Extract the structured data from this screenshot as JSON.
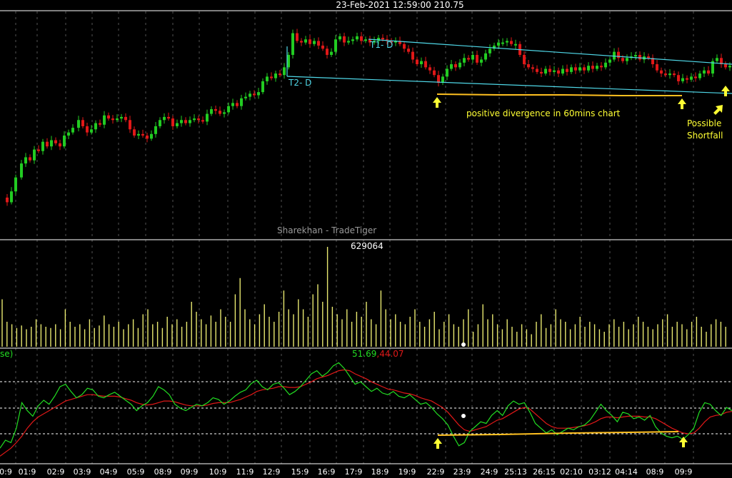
{
  "header": {
    "title": "23-Feb-2021  12:59:00  210.75"
  },
  "watermark": "Sharekhan - TradeTiger",
  "volume_panel": {
    "label": "629064"
  },
  "rsi_panel": {
    "legend_prefix": "se)",
    "value1": "51.69",
    "separator": ",",
    "value2": "44.07"
  },
  "annotations": {
    "trendline_upper": "T1- D",
    "trendline_lower": "T2- D",
    "divergence_text": "positive divergence in 60mins chart",
    "shortfall_line1": "Possible",
    "shortfall_line2": "Shortfall"
  },
  "x_axis_labels": [
    "0:9",
    "01:9",
    "02:9",
    "03:9",
    "04:9",
    "05:9",
    "08:9",
    "09:9",
    "10:9",
    "11:9",
    "12:9",
    "15:9",
    "16:9",
    "17:9",
    "18:9",
    "19:9",
    "22:9",
    "23:9",
    "24:9",
    "25:13",
    "26:15",
    "02:10",
    "03:12",
    "04:14",
    "08:9",
    "09:9"
  ],
  "colors": {
    "background": "#000000",
    "up_candle": "#22cc22",
    "down_candle": "#e01818",
    "trendline": "#4fd8e8",
    "volume": "#e8e870",
    "rsi_line": "#22dd22",
    "rsi_avg": "#e01818",
    "annotation": "#ffff33",
    "support_line": "#ffc020",
    "grid": "#ffffff",
    "text": "#ffffff"
  },
  "chart_data": [
    {
      "type": "candlestick",
      "title": "23-Feb-2021  12:59:00  210.75",
      "close_path": [
        [
          0,
          0.16
        ],
        [
          8,
          0.13
        ],
        [
          14,
          0.2
        ],
        [
          20,
          0.29
        ],
        [
          28,
          0.38
        ],
        [
          34,
          0.42
        ],
        [
          40,
          0.4
        ],
        [
          46,
          0.47
        ],
        [
          52,
          0.46
        ],
        [
          58,
          0.52
        ],
        [
          64,
          0.49
        ],
        [
          70,
          0.53
        ],
        [
          76,
          0.51
        ],
        [
          82,
          0.49
        ],
        [
          88,
          0.56
        ],
        [
          94,
          0.58
        ],
        [
          100,
          0.61
        ],
        [
          108,
          0.66
        ],
        [
          114,
          0.62
        ],
        [
          120,
          0.58
        ],
        [
          126,
          0.6
        ],
        [
          132,
          0.64
        ],
        [
          138,
          0.63
        ],
        [
          144,
          0.69
        ],
        [
          150,
          0.67
        ],
        [
          156,
          0.66
        ],
        [
          162,
          0.67
        ],
        [
          168,
          0.68
        ],
        [
          174,
          0.66
        ],
        [
          180,
          0.6
        ],
        [
          186,
          0.56
        ],
        [
          192,
          0.57
        ],
        [
          198,
          0.56
        ],
        [
          204,
          0.54
        ],
        [
          210,
          0.57
        ],
        [
          216,
          0.62
        ],
        [
          222,
          0.66
        ],
        [
          228,
          0.68
        ],
        [
          234,
          0.67
        ],
        [
          240,
          0.62
        ],
        [
          246,
          0.64
        ],
        [
          252,
          0.66
        ],
        [
          258,
          0.64
        ],
        [
          264,
          0.66
        ],
        [
          270,
          0.67
        ],
        [
          276,
          0.66
        ],
        [
          282,
          0.65
        ],
        [
          288,
          0.7
        ],
        [
          294,
          0.73
        ],
        [
          300,
          0.72
        ],
        [
          306,
          0.7
        ],
        [
          312,
          0.71
        ],
        [
          318,
          0.75
        ],
        [
          324,
          0.77
        ],
        [
          330,
          0.75
        ],
        [
          336,
          0.8
        ],
        [
          342,
          0.81
        ],
        [
          348,
          0.83
        ],
        [
          354,
          0.82
        ],
        [
          360,
          0.84
        ],
        [
          366,
          0.91
        ],
        [
          372,
          0.94
        ],
        [
          378,
          0.93
        ],
        [
          384,
          0.96
        ],
        [
          390,
          0.95
        ],
        [
          396,
          1.0
        ],
        [
          402,
          1.08
        ],
        [
          408,
          1.22
        ],
        [
          414,
          1.17
        ],
        [
          420,
          1.16
        ],
        [
          426,
          1.18
        ],
        [
          432,
          1.15
        ],
        [
          438,
          1.17
        ],
        [
          444,
          1.14
        ],
        [
          450,
          1.12
        ],
        [
          456,
          1.08
        ],
        [
          462,
          1.1
        ],
        [
          468,
          1.18
        ],
        [
          474,
          1.2
        ],
        [
          480,
          1.16
        ],
        [
          486,
          1.17
        ],
        [
          492,
          1.18
        ],
        [
          498,
          1.2
        ],
        [
          504,
          1.17
        ],
        [
          510,
          1.18
        ],
        [
          516,
          1.16
        ],
        [
          522,
          1.17
        ],
        [
          528,
          1.19
        ],
        [
          534,
          1.18
        ],
        [
          540,
          1.17
        ],
        [
          546,
          1.16
        ],
        [
          552,
          1.17
        ],
        [
          558,
          1.15
        ],
        [
          564,
          1.12
        ],
        [
          570,
          1.1
        ],
        [
          576,
          1.05
        ],
        [
          582,
          1.02
        ],
        [
          588,
          1.04
        ],
        [
          594,
          1.0
        ],
        [
          600,
          0.98
        ],
        [
          606,
          0.95
        ],
        [
          612,
          0.9
        ],
        [
          618,
          0.94
        ],
        [
          624,
          0.99
        ],
        [
          630,
          1.02
        ],
        [
          636,
          1.0
        ],
        [
          642,
          1.03
        ],
        [
          648,
          1.06
        ],
        [
          654,
          1.05
        ],
        [
          660,
          1.08
        ],
        [
          666,
          1.03
        ],
        [
          672,
          1.05
        ],
        [
          678,
          1.09
        ],
        [
          684,
          1.12
        ],
        [
          690,
          1.14
        ],
        [
          696,
          1.16
        ],
        [
          702,
          1.16
        ],
        [
          708,
          1.17
        ],
        [
          714,
          1.15
        ],
        [
          720,
          1.15
        ],
        [
          726,
          1.08
        ],
        [
          732,
          1.02
        ],
        [
          738,
          1.0
        ],
        [
          744,
          0.99
        ],
        [
          750,
          0.97
        ],
        [
          756,
          0.96
        ],
        [
          762,
          0.99
        ],
        [
          768,
          0.97
        ],
        [
          774,
          0.98
        ],
        [
          780,
          0.96
        ],
        [
          786,
          0.99
        ],
        [
          792,
          0.97
        ],
        [
          798,
          1.0
        ],
        [
          804,
          0.98
        ],
        [
          810,
          1.0
        ],
        [
          816,
          0.98
        ],
        [
          822,
          1.01
        ],
        [
          828,
          0.99
        ],
        [
          834,
          1.01
        ],
        [
          840,
          1.0
        ],
        [
          846,
          1.03
        ],
        [
          852,
          1.05
        ],
        [
          858,
          1.1
        ],
        [
          864,
          1.06
        ],
        [
          870,
          1.04
        ],
        [
          876,
          1.06
        ],
        [
          882,
          1.07
        ],
        [
          888,
          1.08
        ],
        [
          894,
          1.05
        ],
        [
          900,
          1.07
        ],
        [
          906,
          1.06
        ],
        [
          912,
          1.02
        ],
        [
          918,
          0.98
        ],
        [
          924,
          0.96
        ],
        [
          930,
          0.95
        ],
        [
          936,
          0.96
        ],
        [
          942,
          0.95
        ],
        [
          948,
          0.91
        ],
        [
          954,
          0.93
        ],
        [
          960,
          0.92
        ],
        [
          966,
          0.94
        ],
        [
          972,
          0.93
        ],
        [
          978,
          0.96
        ],
        [
          984,
          0.98
        ],
        [
          990,
          0.96
        ],
        [
          996,
          1.04
        ],
        [
          1002,
          1.06
        ],
        [
          1008,
          1.02
        ],
        [
          1014,
          1.0
        ],
        [
          1020,
          1.01
        ]
      ]
    },
    {
      "type": "bar",
      "title": "629064",
      "description_values_relative": [
        0.38,
        0.2,
        0.18,
        0.15,
        0.17,
        0.14,
        0.16,
        0.22,
        0.18,
        0.16,
        0.15,
        0.18,
        0.14,
        0.3,
        0.2,
        0.16,
        0.18,
        0.14,
        0.22,
        0.15,
        0.17,
        0.25,
        0.18,
        0.16,
        0.2,
        0.14,
        0.18,
        0.22,
        0.15,
        0.26,
        0.3,
        0.18,
        0.2,
        0.15,
        0.24,
        0.18,
        0.22,
        0.16,
        0.2,
        0.36,
        0.28,
        0.22,
        0.18,
        0.25,
        0.2,
        0.3,
        0.24,
        0.2,
        0.42,
        0.55,
        0.3,
        0.22,
        0.18,
        0.26,
        0.34,
        0.24,
        0.2,
        0.28,
        0.45,
        0.3,
        0.26,
        0.38,
        0.3,
        0.24,
        0.42,
        0.5,
        0.36,
        0.8,
        0.32,
        0.26,
        0.22,
        0.3,
        0.2,
        0.28,
        0.24,
        0.36,
        0.22,
        0.18,
        0.45,
        0.3,
        0.22,
        0.26,
        0.2,
        0.18,
        0.24,
        0.3,
        0.2,
        0.16,
        0.22,
        0.28,
        0.14,
        0.2,
        0.26,
        0.18,
        0.16,
        0.22,
        0.3,
        0.12,
        0.18,
        0.34,
        0.22,
        0.26,
        0.18,
        0.14,
        0.22,
        0.16,
        0.12,
        0.18,
        0.14,
        0.1,
        0.2,
        0.26,
        0.15,
        0.18,
        0.3,
        0.22,
        0.2,
        0.14,
        0.18,
        0.24,
        0.16,
        0.2,
        0.18,
        0.14,
        0.12,
        0.18,
        0.22,
        0.16,
        0.2,
        0.14,
        0.18,
        0.24,
        0.2,
        0.16,
        0.14,
        0.18,
        0.22,
        0.26,
        0.16,
        0.2,
        0.18,
        0.14,
        0.2,
        0.24,
        0.16,
        0.12,
        0.18,
        0.22,
        0.2,
        0.16
      ]
    },
    {
      "type": "line",
      "title": "51.69, 44.07",
      "series": [
        {
          "name": "51.69",
          "values": [
            0.15,
            0.25,
            0.22,
            0.4,
            0.72,
            0.62,
            0.55,
            0.68,
            0.75,
            0.7,
            0.8,
            0.92,
            0.95,
            0.86,
            0.78,
            0.82,
            0.9,
            0.88,
            0.8,
            0.78,
            0.82,
            0.85,
            0.8,
            0.75,
            0.7,
            0.62,
            0.68,
            0.72,
            0.8,
            0.92,
            0.88,
            0.82,
            0.7,
            0.65,
            0.62,
            0.66,
            0.7,
            0.68,
            0.72,
            0.78,
            0.76,
            0.7,
            0.74,
            0.8,
            0.85,
            0.88,
            0.96,
            1.0,
            0.92,
            0.88,
            0.95,
            0.97,
            0.9,
            0.82,
            0.86,
            0.92,
            1.0,
            1.08,
            1.12,
            1.05,
            1.1,
            1.18,
            1.22,
            1.15,
            1.05,
            0.95,
            0.98,
            0.92,
            0.86,
            0.9,
            0.84,
            0.82,
            0.86,
            0.8,
            0.78,
            0.82,
            0.76,
            0.7,
            0.72,
            0.66,
            0.58,
            0.52,
            0.44,
            0.3,
            0.18,
            0.22,
            0.36,
            0.42,
            0.48,
            0.46,
            0.56,
            0.62,
            0.56,
            0.68,
            0.74,
            0.7,
            0.72,
            0.6,
            0.46,
            0.4,
            0.34,
            0.38,
            0.32,
            0.36,
            0.4,
            0.38,
            0.42,
            0.44,
            0.5,
            0.6,
            0.7,
            0.62,
            0.56,
            0.48,
            0.6,
            0.58,
            0.52,
            0.54,
            0.5,
            0.56,
            0.42,
            0.34,
            0.3,
            0.28,
            0.3,
            0.26,
            0.32,
            0.4,
            0.6,
            0.72,
            0.7,
            0.62,
            0.56,
            0.66,
            0.62
          ]
        },
        {
          "name": "44.07",
          "values": [
            0.05,
            0.1,
            0.15,
            0.22,
            0.3,
            0.4,
            0.48,
            0.54,
            0.58,
            0.62,
            0.66,
            0.7,
            0.74,
            0.76,
            0.78,
            0.8,
            0.82,
            0.82,
            0.81,
            0.8,
            0.8,
            0.8,
            0.79,
            0.77,
            0.75,
            0.72,
            0.7,
            0.69,
            0.7,
            0.72,
            0.74,
            0.74,
            0.73,
            0.71,
            0.69,
            0.68,
            0.68,
            0.68,
            0.69,
            0.71,
            0.72,
            0.72,
            0.72,
            0.74,
            0.76,
            0.79,
            0.82,
            0.86,
            0.88,
            0.89,
            0.9,
            0.92,
            0.92,
            0.91,
            0.91,
            0.92,
            0.95,
            0.98,
            1.02,
            1.04,
            1.06,
            1.09,
            1.12,
            1.13,
            1.12,
            1.08,
            1.05,
            1.02,
            0.98,
            0.95,
            0.92,
            0.89,
            0.88,
            0.86,
            0.84,
            0.83,
            0.81,
            0.78,
            0.76,
            0.74,
            0.7,
            0.66,
            0.6,
            0.52,
            0.44,
            0.38,
            0.36,
            0.38,
            0.4,
            0.42,
            0.46,
            0.5,
            0.52,
            0.56,
            0.6,
            0.64,
            0.66,
            0.64,
            0.58,
            0.52,
            0.46,
            0.42,
            0.4,
            0.4,
            0.4,
            0.41,
            0.42,
            0.43,
            0.45,
            0.48,
            0.52,
            0.54,
            0.54,
            0.53,
            0.54,
            0.55,
            0.55,
            0.55,
            0.54,
            0.54,
            0.52,
            0.48,
            0.44,
            0.4,
            0.37,
            0.34,
            0.33,
            0.34,
            0.4,
            0.48,
            0.54,
            0.56,
            0.57,
            0.6,
            0.61
          ]
        }
      ]
    }
  ]
}
